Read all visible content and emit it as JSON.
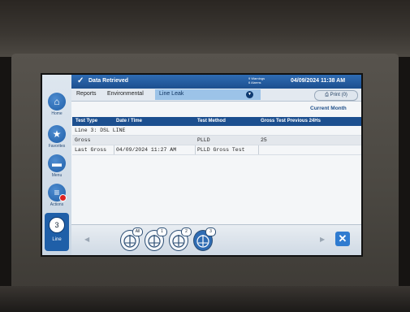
{
  "nav": {
    "home": "Home",
    "favorites": "Favorites",
    "menu": "Menu",
    "actions": "Actions",
    "line_number": "3",
    "line_label": "Line"
  },
  "topbar": {
    "status": "Data Retrieved",
    "warnings": "9 Warnings",
    "alarms": "6 Alarms",
    "datetime": "04/09/2024 11:38 AM"
  },
  "breadcrumb": {
    "items": [
      "Reports",
      "Environmental",
      "Line Leak"
    ],
    "print": "Print (0)"
  },
  "period": "Current Month",
  "table": {
    "headers": [
      "Test Type",
      "Date / Time",
      "Test Method",
      "Gross Test Previous 24Hs"
    ],
    "group_row": "Line 3: DSL LINE",
    "rows": [
      [
        "Gross",
        "",
        "PLLD",
        "25"
      ],
      [
        "Last Gross",
        "04/09/2024 11:27 AM",
        "PLLD Gross Test",
        ""
      ]
    ]
  },
  "tabs": [
    "All",
    "1",
    "2",
    "3"
  ],
  "selected_tab": "3",
  "colors": {
    "accent": "#1c4f8f",
    "selected_crumb": "#9cc3e8",
    "close": "#2f7bd0"
  }
}
